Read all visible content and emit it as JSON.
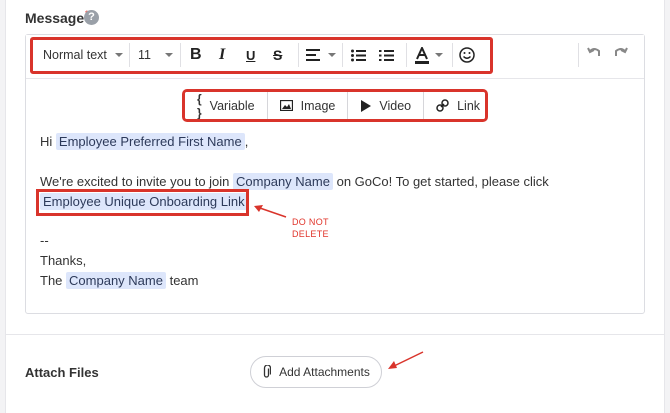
{
  "message": {
    "label": "Message",
    "required_mark": "*",
    "help_icon": "?"
  },
  "toolbar": {
    "text_style": "Normal text",
    "font_size": "11",
    "bold": "B",
    "italic": "I",
    "underline": "U",
    "strike": "S"
  },
  "insert_bar": {
    "variable": "Variable",
    "image": "Image",
    "video": "Video",
    "link": "Link"
  },
  "body": {
    "line1_prefix": "Hi",
    "line1_token": "Employee Preferred First Name",
    "line1_suffix": ",",
    "line2_prefix": "We're excited to invite you to join",
    "line2_token": "Company Name",
    "line2_suffix": "on GoCo! To get started, please click",
    "link_token": "Employee Unique Onboarding Link",
    "dashes": "--",
    "thanks": "Thanks,",
    "sign_prefix": "The",
    "sign_token": "Company Name",
    "sign_suffix": "team"
  },
  "annotation": {
    "line1": "DO NOT",
    "line2": "DELETE"
  },
  "attach": {
    "label": "Attach Files",
    "button": "Add Attachments"
  },
  "colors": {
    "accent_red": "#d9342b",
    "token_bg": "#dde6fb"
  }
}
